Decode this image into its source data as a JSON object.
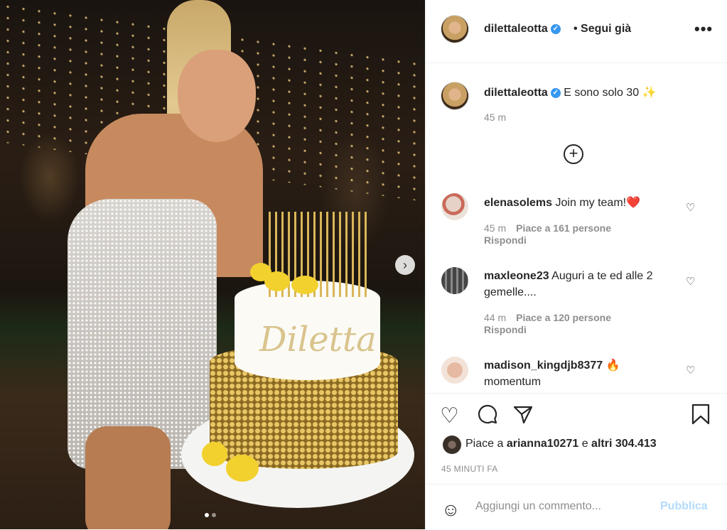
{
  "post": {
    "username": "dilettaleotta",
    "follow_label": "• Segui già",
    "more_label": "•••",
    "caption": {
      "username": "dilettaleotta",
      "text": "E sono solo 30 ✨",
      "time": "45 m"
    },
    "add_comments_label": "+",
    "comments": [
      {
        "username": "elenasolems",
        "text": "Join my team!❤️",
        "time": "45 m",
        "likes": "Piace a 161 persone",
        "reply": "Rispondi"
      },
      {
        "username": "maxleone23",
        "text": "Auguri a te ed alle 2 gemelle....",
        "time": "44 m",
        "likes": "Piace a 120 persone",
        "reply": "Rispondi"
      },
      {
        "username": "madison_kingdjb8377",
        "text": "🔥 momentum",
        "time": "",
        "likes": "",
        "reply": ""
      }
    ],
    "actions": {
      "like_icon": "heart-outline-icon",
      "comment_icon": "comment-bubble-icon",
      "share_icon": "paper-plane-icon",
      "save_icon": "bookmark-icon"
    },
    "likes_text_prefix": "Piace a",
    "likes_user": "arianna10271",
    "likes_text_middle": "e",
    "likes_others": "altri 304.413",
    "timestamp": "45 MINUTI FA",
    "comment_placeholder": "Aggiungi un commento...",
    "publish_label": "Pubblica",
    "photo_cake_text": "Diletta",
    "carousel": {
      "current": 1,
      "total": 2
    }
  }
}
